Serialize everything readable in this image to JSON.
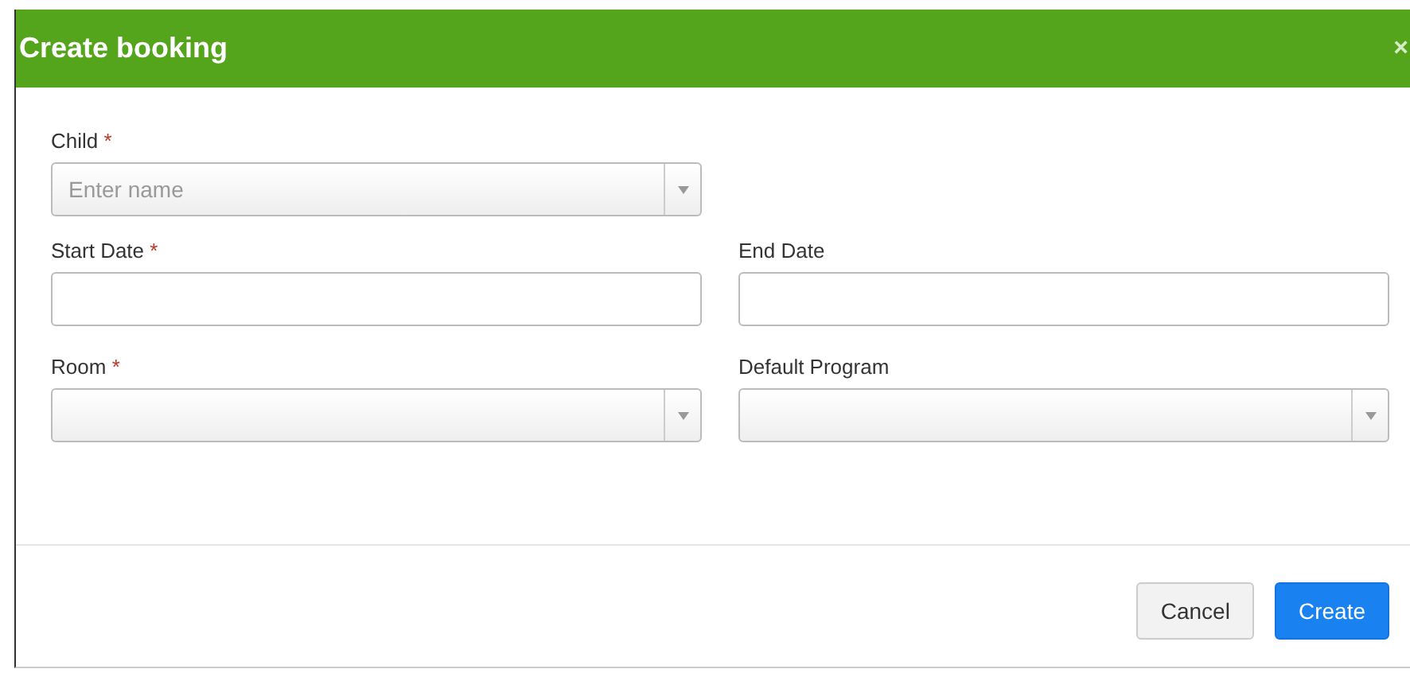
{
  "dialog": {
    "title": "Create booking",
    "close": "×"
  },
  "rows": [
    [
      {
        "label": "Child",
        "required": true,
        "kind": "select",
        "placeholder": "Enter name"
      }
    ],
    [
      {
        "label": "Start Date",
        "required": true,
        "kind": "text"
      },
      {
        "label": "End Date",
        "required": false,
        "kind": "text"
      }
    ],
    [
      {
        "label": "Room",
        "required": true,
        "kind": "select"
      },
      {
        "label": "Default Program",
        "required": false,
        "kind": "select"
      }
    ]
  ],
  "required_mark": "*",
  "buttons": [
    {
      "label": "Cancel",
      "kind": "secondary"
    },
    {
      "label": "Create",
      "kind": "primary"
    }
  ]
}
